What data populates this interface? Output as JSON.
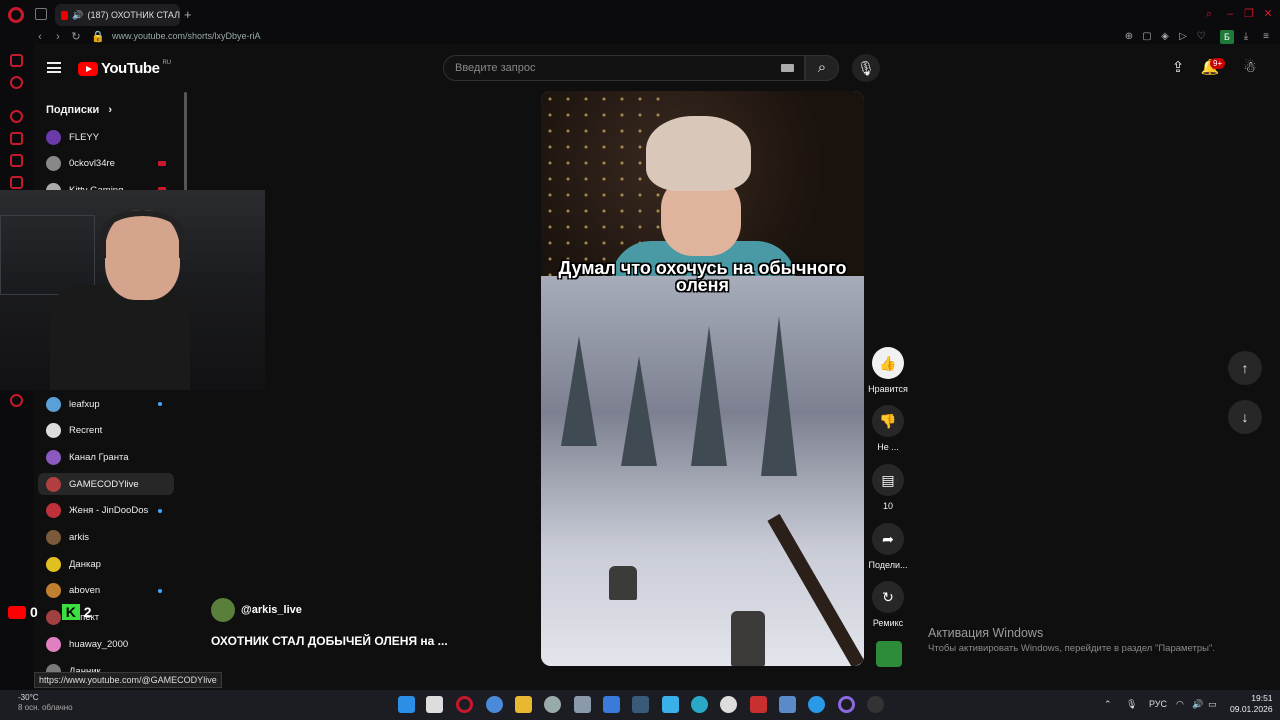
{
  "browser": {
    "tab_title": "(187) ОХОТНИК СТАЛ",
    "url": "www.youtube.com/shorts/lxyDbye-riA",
    "profile_badge": "Б",
    "colors": {
      "accent": "#c8192c"
    }
  },
  "youtube": {
    "logo_text": "YouTube",
    "region": "RU",
    "search_placeholder": "Введите запрос",
    "notification_count": "9+"
  },
  "sidebar": {
    "subscriptions_label": "Подписки",
    "chevron": "›",
    "items_top": [
      {
        "name": "FLEYY",
        "live": "none",
        "color": "#6a3aa8"
      },
      {
        "name": "0ckovl34re",
        "live": "red",
        "color": "#888888"
      },
      {
        "name": "Kitty Gaming",
        "live": "red",
        "color": "#aaaaaa"
      }
    ],
    "items": [
      {
        "name": "leafxup",
        "live": "dot",
        "color": "#5aa0d8"
      },
      {
        "name": "Recrent",
        "live": "none",
        "color": "#dddddd"
      },
      {
        "name": "Канал Гранта",
        "live": "none",
        "color": "#8a5ac0"
      },
      {
        "name": "GAMECODYlive",
        "live": "none",
        "color": "#b04040",
        "active": true
      },
      {
        "name": "Женя - JinDooDos",
        "live": "dot",
        "color": "#c0303a"
      },
      {
        "name": "arkis",
        "live": "none",
        "color": "#7a5a3a"
      },
      {
        "name": "Данкар",
        "live": "none",
        "color": "#e0c020"
      },
      {
        "name": "aboven",
        "live": "dot",
        "color": "#c08030"
      },
      {
        "name": "Аспект",
        "live": "none",
        "color": "#a04040"
      },
      {
        "name": "huaway_2000",
        "live": "none",
        "color": "#e080c0"
      },
      {
        "name": "Данник",
        "live": "none",
        "color": "#7a7a7a"
      }
    ]
  },
  "short": {
    "caption": "Думал что охочусь на обычного оленя",
    "author": "@arkis_live",
    "title": "ОХОТНИК СТАЛ ДОБЫЧЕЙ ОЛЕНЯ на ..."
  },
  "actions": {
    "like": "Нравится",
    "dislike": "Не ...",
    "comments": "10",
    "share": "Подели...",
    "remix": "Ремикс"
  },
  "overlay": {
    "yt_count": "0",
    "k_count": "2"
  },
  "status_url": "https://www.youtube.com/@GAMECODYlive",
  "windows": {
    "activate_title": "Активация Windows",
    "activate_text": "Чтобы активировать Windows, перейдите в раздел \"Параметры\".",
    "temperature": "-30°C",
    "weather": "8 осн. облачно",
    "lang": "РУС",
    "time": "19:51",
    "date": "09.01.2026"
  }
}
